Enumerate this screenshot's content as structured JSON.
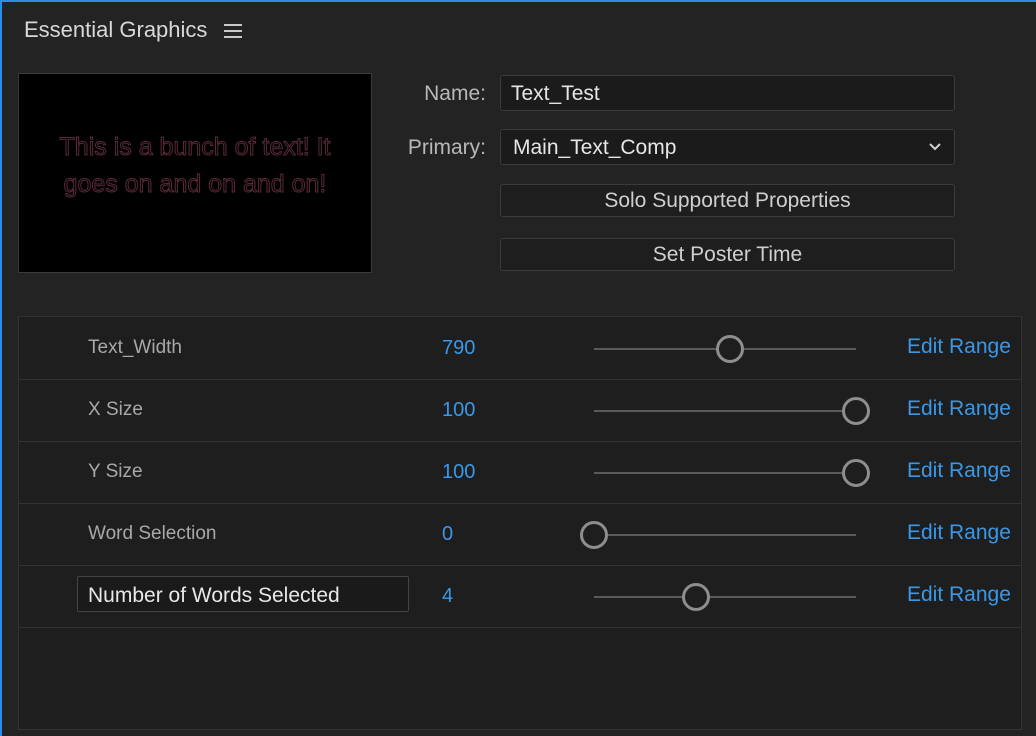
{
  "panel": {
    "title": "Essential Graphics"
  },
  "preview": {
    "text": "This is a bunch of text! It goes on and on and on!"
  },
  "fields": {
    "name_label": "Name:",
    "name_value": "Text_Test",
    "primary_label": "Primary:",
    "primary_value": "Main_Text_Comp"
  },
  "buttons": {
    "solo": "Solo Supported Properties",
    "poster": "Set Poster Time"
  },
  "properties": [
    {
      "label": "Text_Width",
      "value": "790",
      "fraction": 0.52,
      "edit": "Edit Range"
    },
    {
      "label": "X Size",
      "value": "100",
      "fraction": 1.0,
      "edit": "Edit Range"
    },
    {
      "label": "Y Size",
      "value": "100",
      "fraction": 1.0,
      "edit": "Edit Range"
    },
    {
      "label": "Word Selection",
      "value": "0",
      "fraction": 0.0,
      "edit": "Edit Range"
    },
    {
      "label": "Number of Words Selected",
      "value": "4",
      "fraction": 0.39,
      "edit": "Edit Range",
      "editing": true
    }
  ],
  "colors": {
    "accent": "#3a98e8",
    "focus_border": "#2d8ceb"
  }
}
